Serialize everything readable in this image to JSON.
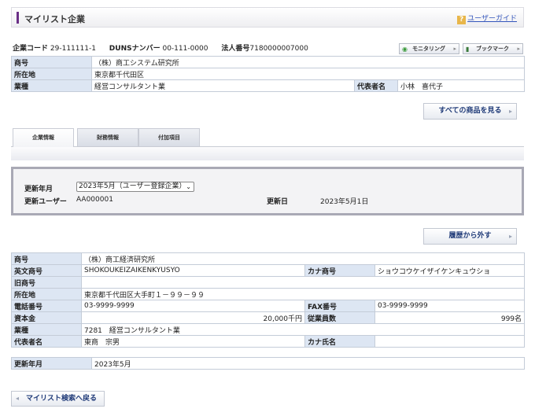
{
  "header": {
    "title": "マイリスト企業",
    "guide_icon": "?",
    "guide_label": "ユーザーガイド"
  },
  "codes": {
    "company_code_label": "企業コード",
    "company_code": "29-111111-1",
    "duns_label": "DUNSナンバー",
    "duns": "00-111-0000",
    "corp_no_label": "法人番号",
    "corp_no": "7180000007000"
  },
  "toolbar": {
    "monitoring_label": "モニタリング",
    "bookmark_label": "ブックマーク"
  },
  "summary": {
    "name_label": "商号",
    "name": "（株）商工システム研究所",
    "address_label": "所在地",
    "address": "東京都千代田区",
    "industry_label": "業種",
    "industry": "経営コンサルタント業",
    "rep_label": "代表者名",
    "rep": "小林　喜代子"
  },
  "all_products_label": "すべての商品を見る",
  "tabs": [
    "企業情報",
    "財務情報",
    "付加項目"
  ],
  "update": {
    "year_month_label": "更新年月",
    "year_month_value": "2023年5月（ユーザー登録企業）",
    "user_label": "更新ユーザー",
    "user": "AA000001",
    "date_label": "更新日",
    "date": "2023年5月1日"
  },
  "remove_label": "履歴から外す",
  "detail": {
    "name_label": "商号",
    "name": "（株）商工経済研究所",
    "en_name_label": "英文商号",
    "en_name": "SHOKOUKEIZAIKENKYUSYO",
    "kana_label": "カナ商号",
    "kana": "ショウコウケイザイケンキュウショ",
    "old_name_label": "旧商号",
    "old_name": "",
    "address_label": "所在地",
    "address": "東京都千代田区大手町１－９９－９９",
    "tel_label": "電話番号",
    "tel": "03-9999-9999",
    "fax_label": "FAX番号",
    "fax": "03-9999-9999",
    "capital_label": "資本金",
    "capital": "20,000千円",
    "employees_label": "従業員数",
    "employees": "999名",
    "industry_label": "業種",
    "industry": "7281　経営コンサルタント業",
    "rep_label": "代表者名",
    "rep": "東商　宗男",
    "rep_kana_label": "カナ氏名",
    "rep_kana": ""
  },
  "footer_update": {
    "label": "更新年月",
    "value": "2023年5月"
  },
  "back_label": "マイリスト検索へ戻る"
}
